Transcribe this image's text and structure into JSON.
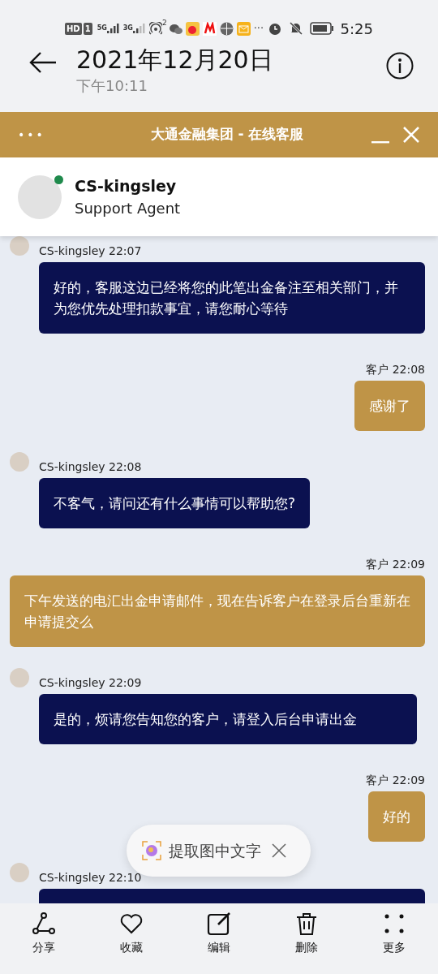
{
  "status_bar": {
    "network_labels": [
      "HD",
      "1",
      "5G",
      "3G"
    ],
    "hotspot_count": "2",
    "more": "···",
    "time": "5:25"
  },
  "viewer_header": {
    "title": "2021年12月20日",
    "subtitle": "下午10:11"
  },
  "chat_window": {
    "menu": "•••",
    "title": "大通金融集团 - 在线客服"
  },
  "agent": {
    "name": "CS-kingsley",
    "role": "Support Agent",
    "online": true
  },
  "messages": [
    {
      "kind": "agent",
      "meta": "CS-kingsley 22:07",
      "text": "好的，客服这边已经将您的此笔出金备注至相关部门，并为您优先处理扣款事宜，请您耐心等待"
    },
    {
      "kind": "customer",
      "meta": "客户 22:08",
      "text": "感谢了"
    },
    {
      "kind": "agent",
      "meta": "CS-kingsley 22:08",
      "text": "不客气，请问还有什么事情可以帮助您?"
    },
    {
      "kind": "customer",
      "meta": "客户 22:09",
      "text": "下午发送的电汇出金申请邮件，现在告诉客户在登录后台重新在申请提交么"
    },
    {
      "kind": "agent",
      "meta": "CS-kingsley 22:09",
      "text": "是的，烦请您告知您的客户，请登入后台申请出金"
    },
    {
      "kind": "customer",
      "meta": "客户 22:09",
      "text": "好的"
    },
    {
      "kind": "agent",
      "meta": "CS-kingsley 22:10"
    }
  ],
  "toast": {
    "label": "提取图中文字"
  },
  "toolbar": [
    {
      "kind": "share",
      "label": "分享"
    },
    {
      "kind": "favorite",
      "label": "收藏"
    },
    {
      "kind": "edit",
      "label": "编辑"
    },
    {
      "kind": "delete",
      "label": "删除"
    },
    {
      "kind": "more",
      "label": "更多"
    }
  ]
}
